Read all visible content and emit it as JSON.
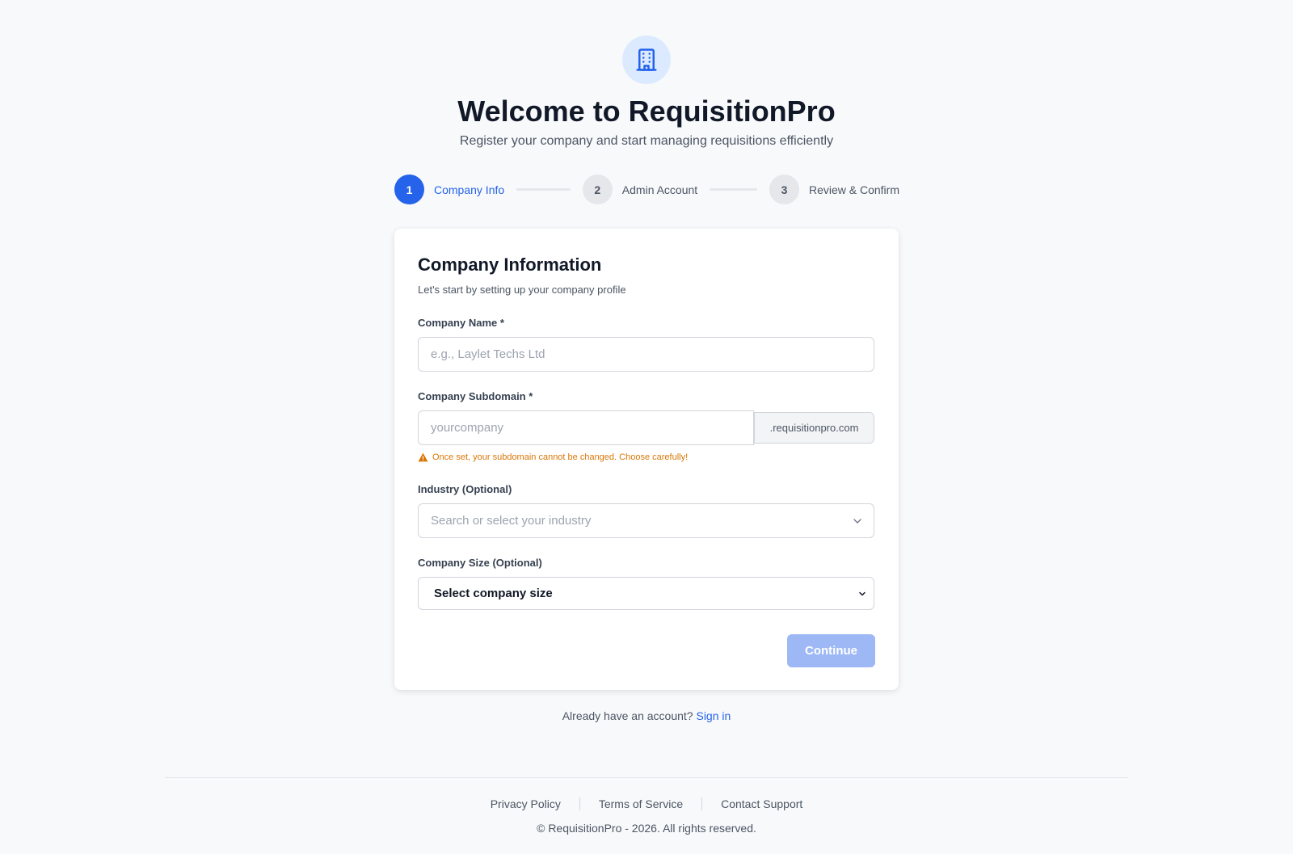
{
  "header": {
    "logo_icon": "building-icon",
    "title": "Welcome to RequisitionPro",
    "subtitle": "Register your company and start managing requisitions efficiently"
  },
  "stepper": {
    "steps": [
      {
        "number": "1",
        "label": "Company Info",
        "active": true
      },
      {
        "number": "2",
        "label": "Admin Account",
        "active": false
      },
      {
        "number": "3",
        "label": "Review & Confirm",
        "active": false
      }
    ]
  },
  "form": {
    "title": "Company Information",
    "subtitle": "Let's start by setting up your company profile",
    "company_name": {
      "label": "Company Name *",
      "placeholder": "e.g., Laylet Techs Ltd",
      "value": ""
    },
    "subdomain": {
      "label": "Company Subdomain *",
      "placeholder": "yourcompany",
      "value": "",
      "suffix": ".requisitionpro.com",
      "warning": "Once set, your subdomain cannot be changed. Choose carefully!"
    },
    "industry": {
      "label": "Industry (Optional)",
      "placeholder": "Search or select your industry"
    },
    "company_size": {
      "label": "Company Size (Optional)",
      "selected": "Select company size"
    },
    "continue_label": "Continue"
  },
  "signin": {
    "prompt": "Already have an account?",
    "link_label": "Sign in"
  },
  "footer": {
    "links": [
      "Privacy Policy",
      "Terms of Service",
      "Contact Support"
    ],
    "copyright": "© RequisitionPro - 2026. All rights reserved."
  },
  "colors": {
    "primary": "#2563eb",
    "primary_disabled": "#9db8f5",
    "warning": "#d97706",
    "background": "#f8f9fb"
  }
}
